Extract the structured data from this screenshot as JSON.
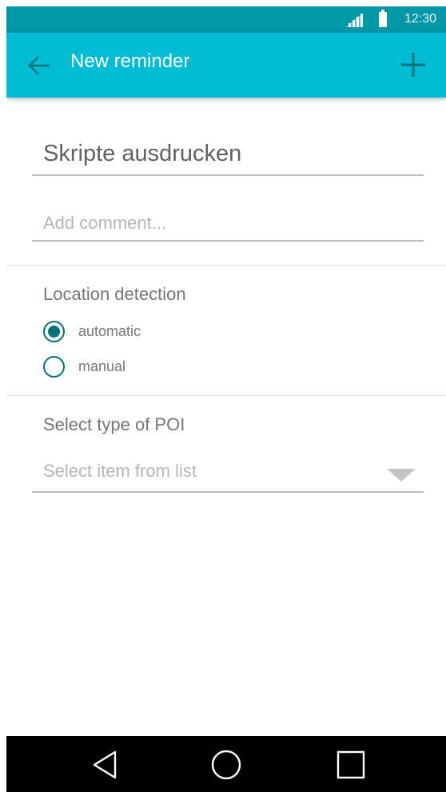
{
  "status_bar": {
    "time": "12:30",
    "signal_icon": "signal-icon",
    "battery_icon": "battery-icon"
  },
  "app_bar": {
    "title": "New reminder",
    "back_icon": "arrow-back-icon",
    "add_icon": "plus-icon",
    "background_color": "#00bcd4",
    "status_color": "#0097a7"
  },
  "form": {
    "title_value": "Skripte ausdrucken",
    "comment_placeholder": "Add comment...",
    "location": {
      "label": "Location detection",
      "options": [
        {
          "label": "automatic",
          "selected": true
        },
        {
          "label": "manual",
          "selected": false
        }
      ],
      "accent_color": "#00737a"
    },
    "poi": {
      "label": "Select type of POI",
      "placeholder": "Select item from list",
      "dropdown_icon": "triangle-down-icon"
    }
  },
  "nav_bar": {
    "back_icon": "nav-back-icon",
    "home_icon": "nav-home-icon",
    "recents_icon": "nav-recents-icon"
  }
}
